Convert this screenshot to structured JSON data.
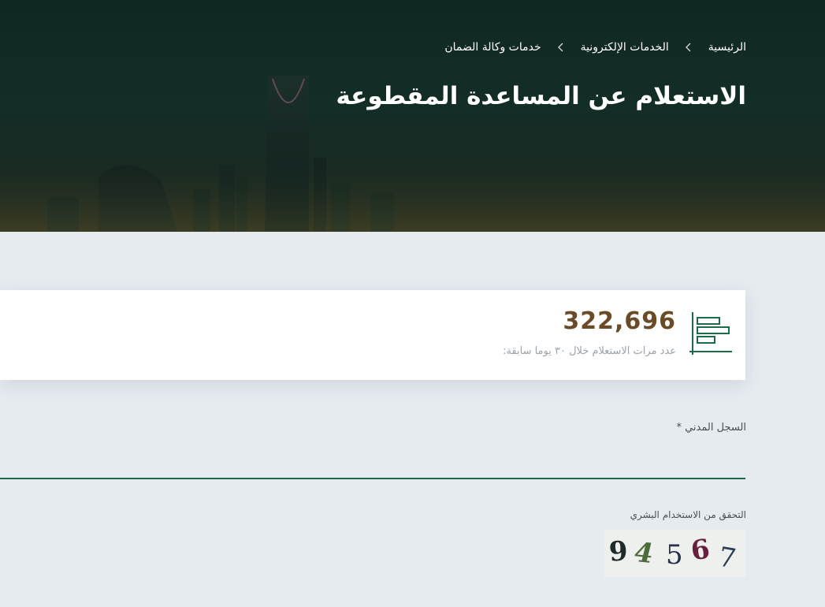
{
  "breadcrumb": {
    "items": [
      {
        "label": "الرئيسية"
      },
      {
        "label": "الخدمات الإلكترونية"
      },
      {
        "label": "خدمات وكالة الضمان"
      }
    ]
  },
  "page_title": "الاستعلام عن المساعدة المقطوعة",
  "stats": {
    "value": "322,696",
    "label": "عدد مرات الاستعلام خلال ٣٠ يوما سابقة:",
    "icon": "bar-chart-icon"
  },
  "form": {
    "civil_registry": {
      "label": "السجل المدني *",
      "value": "",
      "placeholder": ""
    },
    "captcha": {
      "label": "التحقق من الاستخدام البشري",
      "chars": [
        {
          "char": "9",
          "color": "#1f2a2a"
        },
        {
          "char": "4",
          "color": "#4d6e3a"
        },
        {
          "char": "5",
          "color": "#2a2f4a"
        },
        {
          "char": "6",
          "color": "#6a1f3c"
        },
        {
          "char": "7",
          "color": "#2a3f55"
        }
      ]
    }
  },
  "colors": {
    "hero_bg": "#132d27",
    "accent_green": "#1b6b48",
    "stat_value": "#6b4a28",
    "page_bg": "#e6ebf0"
  }
}
